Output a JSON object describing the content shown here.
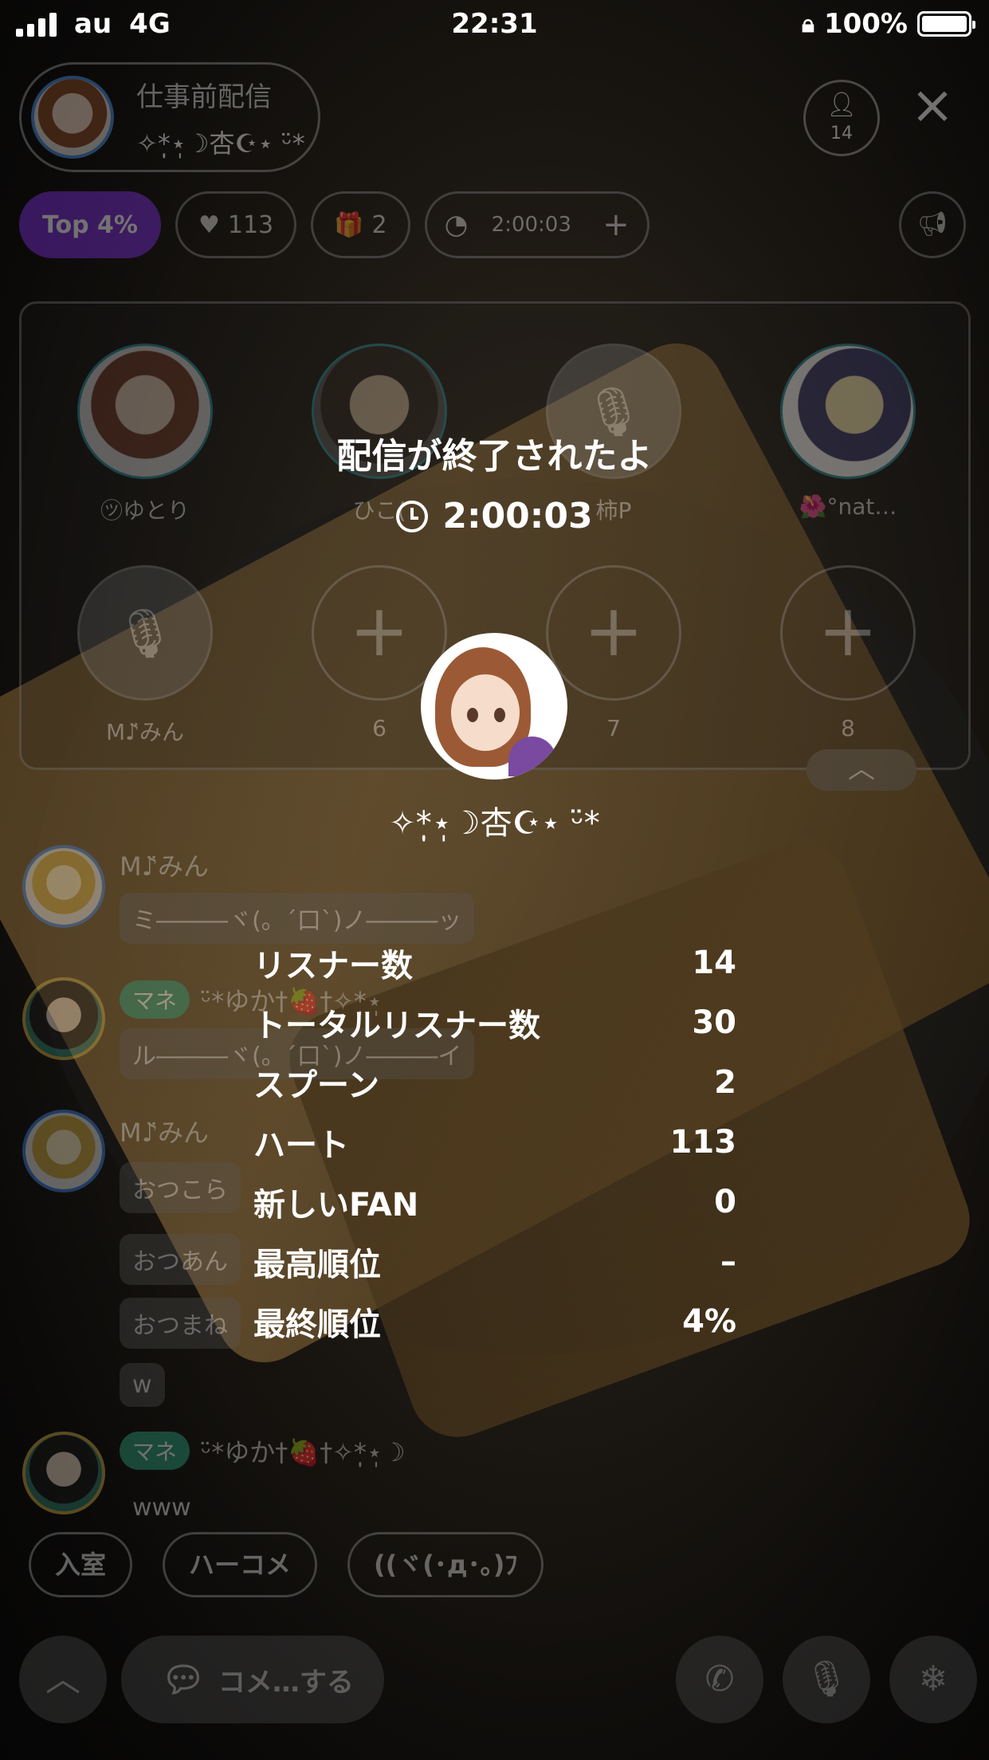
{
  "status_bar": {
    "carrier": "au",
    "network": "4G",
    "time": "22:31",
    "battery": "100%"
  },
  "header": {
    "title": "仕事前配信",
    "host_name": "✧*̣̩⋆̩☽杏☪︎⋆ ᵕ̈*",
    "listener_count": "14",
    "close_icon": "close-icon"
  },
  "chips": {
    "rank": "Top 4%",
    "hearts": "113",
    "spoons": "2",
    "timer": "2:00:03",
    "timer_plus": "+"
  },
  "guests": [
    {
      "label": "㋡ゆとり",
      "type": "filled"
    },
    {
      "label": "ひこ(",
      "type": "filled"
    },
    {
      "label": "柿P",
      "type": "muted"
    },
    {
      "label": "🌺°nat…",
      "type": "filled"
    },
    {
      "label": "M♪̈みん",
      "type": "muted"
    },
    {
      "label": "6",
      "type": "plus"
    },
    {
      "label": "7",
      "type": "plus"
    },
    {
      "label": "8",
      "type": "plus"
    }
  ],
  "chat": {
    "m1_name": "M♪̈みん",
    "m1_text": "ミ―――ヾ(。´口`)ノ―――ッ",
    "m2_badge": "マネ",
    "m2_name": "ᵕ̈*ゆか†🍓†✧*̣̩⋆̩",
    "m2_text": "ル―――ヾ(。´口`)ノ―――イ",
    "m3_name": "M♪̈みん",
    "m3_texts": [
      "おつこら",
      "おつあん",
      "おつまね",
      "w"
    ],
    "m4_badge": "マネ",
    "m4_name": "ᵕ̈*ゆか†🍓†✧*̣̩⋆̩☽",
    "m4_text": "www"
  },
  "quick_replies": [
    "入室",
    "ハーコメ",
    "((ヾ(･д･｡)ﾌ"
  ],
  "bottom": {
    "comment_placeholder": "コメ…する"
  },
  "modal": {
    "ended_text": "配信が終了されたよ",
    "duration": "2:00:03",
    "user_name": "✧*̣̩⋆̩☽杏☪︎⋆ ᵕ̈*",
    "stats": [
      {
        "label": "リスナー数",
        "value": "14"
      },
      {
        "label": "トータルリスナー数",
        "value": "30"
      },
      {
        "label": "スプーン",
        "value": "2"
      },
      {
        "label": "ハート",
        "value": "113"
      },
      {
        "label": "新しいFAN",
        "value": "0"
      },
      {
        "label": "最高順位",
        "value": "–"
      },
      {
        "label": "最終順位",
        "value": "4%"
      }
    ]
  }
}
